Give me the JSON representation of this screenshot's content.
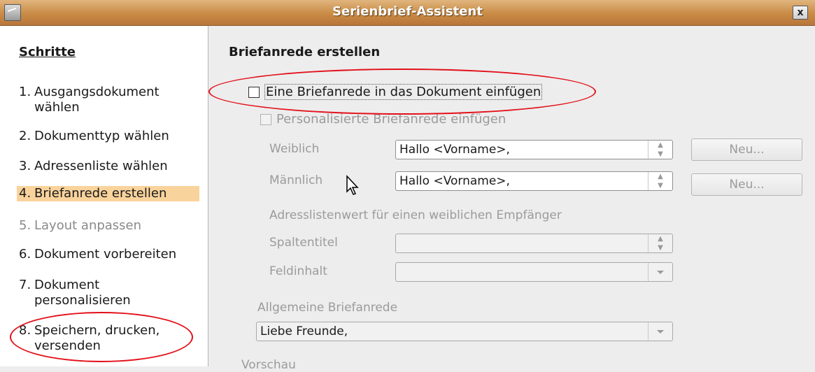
{
  "window": {
    "title": "Serienbrief-Assistent",
    "close_label": "x"
  },
  "sidebar": {
    "title": "Schritte",
    "steps": [
      {
        "num": "1.",
        "label": "Ausgangsdokument wählen"
      },
      {
        "num": "2.",
        "label": "Dokumenttyp wählen"
      },
      {
        "num": "3.",
        "label": "Adressenliste wählen"
      },
      {
        "num": "4.",
        "label": "Briefanrede erstellen"
      },
      {
        "num": "5.",
        "label": "Layout anpassen"
      },
      {
        "num": "6.",
        "label": "Dokument vorbereiten"
      },
      {
        "num": "7.",
        "label": "Dokument personalisieren"
      },
      {
        "num": "8.",
        "label": "Speichern, drucken, versenden"
      }
    ]
  },
  "main": {
    "title": "Briefanrede erstellen",
    "insert_salutation": {
      "label": "Eine Briefanrede in das Dokument einfügen",
      "checked": false
    },
    "personalized": {
      "label": "Personalisierte Briefanrede einfügen",
      "checked": false
    },
    "female": {
      "label": "Weiblich",
      "value": "Hallo <Vorname>,",
      "new_button": "Neu..."
    },
    "male": {
      "label": "Männlich",
      "value": "Hallo <Vorname>,",
      "new_button": "Neu..."
    },
    "address_list_heading": "Adresslistenwert für einen weiblichen Empfänger",
    "column_title": {
      "label": "Spaltentitel",
      "value": ""
    },
    "field_content": {
      "label": "Feldinhalt",
      "value": ""
    },
    "general": {
      "label": "Allgemeine Briefanrede",
      "value": "Liebe Freunde,"
    },
    "preview_label": "Vorschau"
  },
  "annotations": {
    "ellipse_color": "#e3101a"
  },
  "colors": {
    "titlebar": "#c98b45",
    "active_step": "#f9d39c"
  }
}
